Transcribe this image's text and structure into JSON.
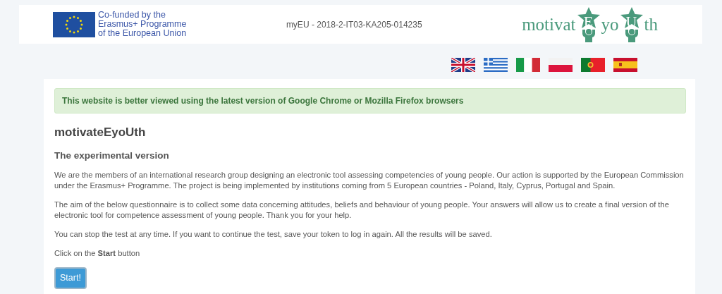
{
  "header": {
    "funding_lines": [
      "Co-funded by the",
      "Erasmus+ Programme",
      "of the European Union"
    ],
    "project_code": "myEU - 2018-2-IT03-KA205-014235",
    "logo_parts": [
      {
        "kind": "plain",
        "text": "motivat"
      },
      {
        "kind": "star",
        "text": "E"
      },
      {
        "kind": "plain",
        "text": "yo"
      },
      {
        "kind": "star",
        "text": "U"
      },
      {
        "kind": "plain",
        "text": "th"
      }
    ]
  },
  "languages": [
    {
      "kind": "uk"
    },
    {
      "kind": "gr"
    },
    {
      "kind": "it"
    },
    {
      "kind": "pl"
    },
    {
      "kind": "pt"
    },
    {
      "kind": "es"
    }
  ],
  "alert": "This website is better viewed using the latest version of Google Chrome or Mozilla Firefox browsers",
  "title": "motivateEyoUth",
  "subtitle": "The experimental version",
  "paragraphs": [
    "We are the members of an international research group designing an electronic tool assessing competencies of young people. Our action is supported by the European Commission under the Erasmus+ Programme. The project is being implemented by institutions coming from 5 European countries - Poland, Italy, Cyprus, Portugal and Spain.",
    "The aim of the below questionnaire is to collect some data concerning attitudes, beliefs and behaviour of young people. Your answers will allow us to create a final version of the electronic tool for competence assessment of young people. Thank you for your help.",
    "You can stop the test at any time. If you want to continue the test, save your token to log in again. All the results will be saved.",
    "Click on the **Start** button"
  ],
  "start_button": "Start!"
}
